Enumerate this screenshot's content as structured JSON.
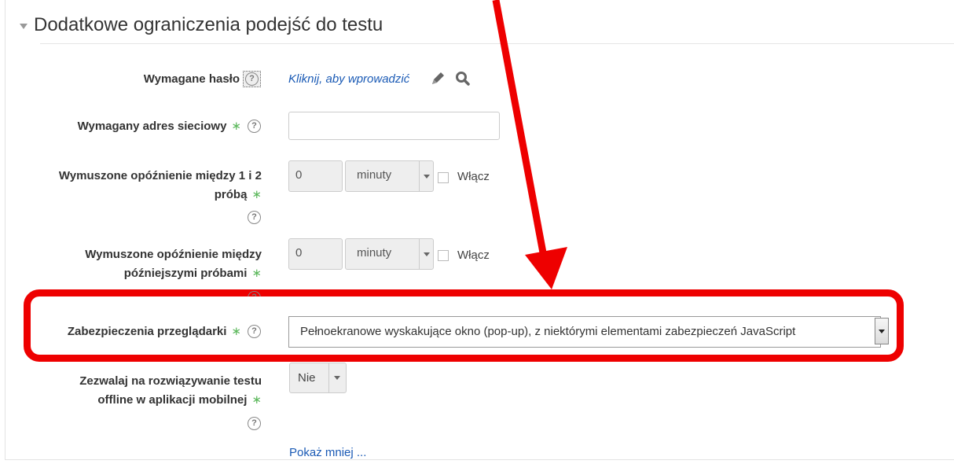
{
  "section": {
    "title": "Dodatkowe ograniczenia podejść do testu"
  },
  "password": {
    "label": "Wymagane hasło",
    "link": "Kliknij, aby wprowadzić"
  },
  "network": {
    "label": "Wymagany adres sieciowy",
    "value": ""
  },
  "delay1": {
    "label_line1": "Wymuszone opóźnienie między 1 i 2",
    "label_line2": "próbą",
    "value": "0",
    "unit": "minuty",
    "enable_label": "Włącz"
  },
  "delay2": {
    "label_line1": "Wymuszone opóźnienie między",
    "label_line2": "późniejszymi próbami",
    "value": "0",
    "unit": "minuty",
    "enable_label": "Włącz"
  },
  "browser_security": {
    "label": "Zabezpieczenia przeglądarki",
    "value": "Pełnoekranowe wyskakujące okno (pop-up), z niektórymi elementami zabezpieczeń JavaScript"
  },
  "offline": {
    "label_line1": "Zezwalaj na rozwiązywanie testu",
    "label_line2": "offline w aplikacji mobilnej",
    "value": "Nie"
  },
  "show_less": "Pokaż mniej ...",
  "required_mark": "∗",
  "help_glyph": "?",
  "colors": {
    "annotation_red": "#ee0000",
    "link_blue": "#1a5ab5",
    "required_green": "#5cb85c"
  },
  "icons": {
    "edit": "pencil-icon",
    "search": "magnifier-icon",
    "help": "question-circle-icon"
  }
}
